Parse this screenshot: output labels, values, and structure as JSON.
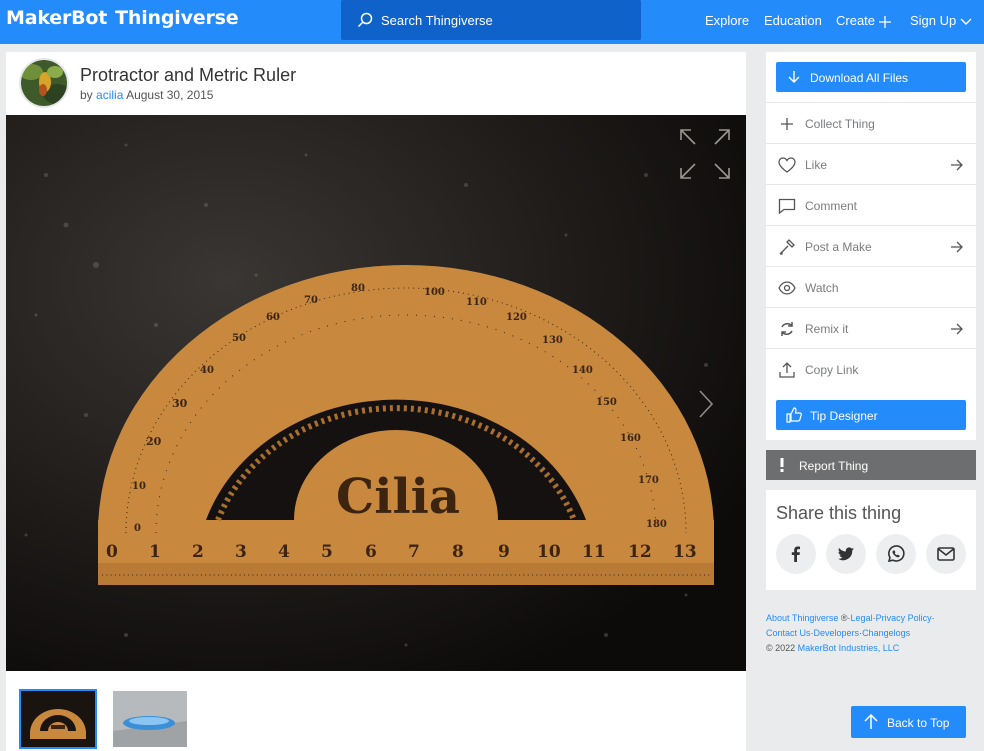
{
  "header": {
    "brand_maker": "MakerBot",
    "brand_thing": "Thingiverse",
    "search_placeholder": "Search Thingiverse",
    "nav": {
      "explore": "Explore",
      "education": "Education",
      "create": "Create",
      "signup": "Sign Up"
    }
  },
  "thing": {
    "title": "Protractor and Metric Ruler",
    "by": "by",
    "author": "acilia",
    "date": "August 30, 2015",
    "photo_text": "Cilia",
    "ruler_numbers": [
      "0",
      "1",
      "2",
      "3",
      "4",
      "5",
      "6",
      "7",
      "8",
      "9",
      "10",
      "11",
      "12",
      "13"
    ],
    "protractor_left": [
      "0",
      "10",
      "20",
      "30",
      "40",
      "50",
      "60",
      "70",
      "80"
    ],
    "protractor_right": [
      "100",
      "110",
      "120",
      "130",
      "140",
      "150",
      "160",
      "170",
      "180"
    ]
  },
  "actions": {
    "download": "Download All Files",
    "collect": "Collect Thing",
    "like": "Like",
    "comment": "Comment",
    "post_make": "Post a Make",
    "watch": "Watch",
    "remix": "Remix it",
    "copy_link": "Copy Link",
    "tip": "Tip Designer",
    "report": "Report Thing"
  },
  "share": {
    "heading": "Share this thing",
    "icons": [
      "facebook-icon",
      "twitter-icon",
      "whatsapp-icon",
      "email-icon"
    ]
  },
  "footer": {
    "about": "About Thingiverse",
    "reg": "®",
    "legal": "Legal",
    "privacy": "Privacy Policy",
    "contact": "Contact Us",
    "developers": "Developers",
    "changelogs": "Changelogs",
    "copyright": "©  2022",
    "company": "MakerBot Industries, LLC"
  },
  "back_to_top": "Back to Top",
  "colors": {
    "brand": "#248bfb",
    "search_bg": "#0e62c9",
    "report": "#6d6e70",
    "page_bg": "#eaebed"
  }
}
